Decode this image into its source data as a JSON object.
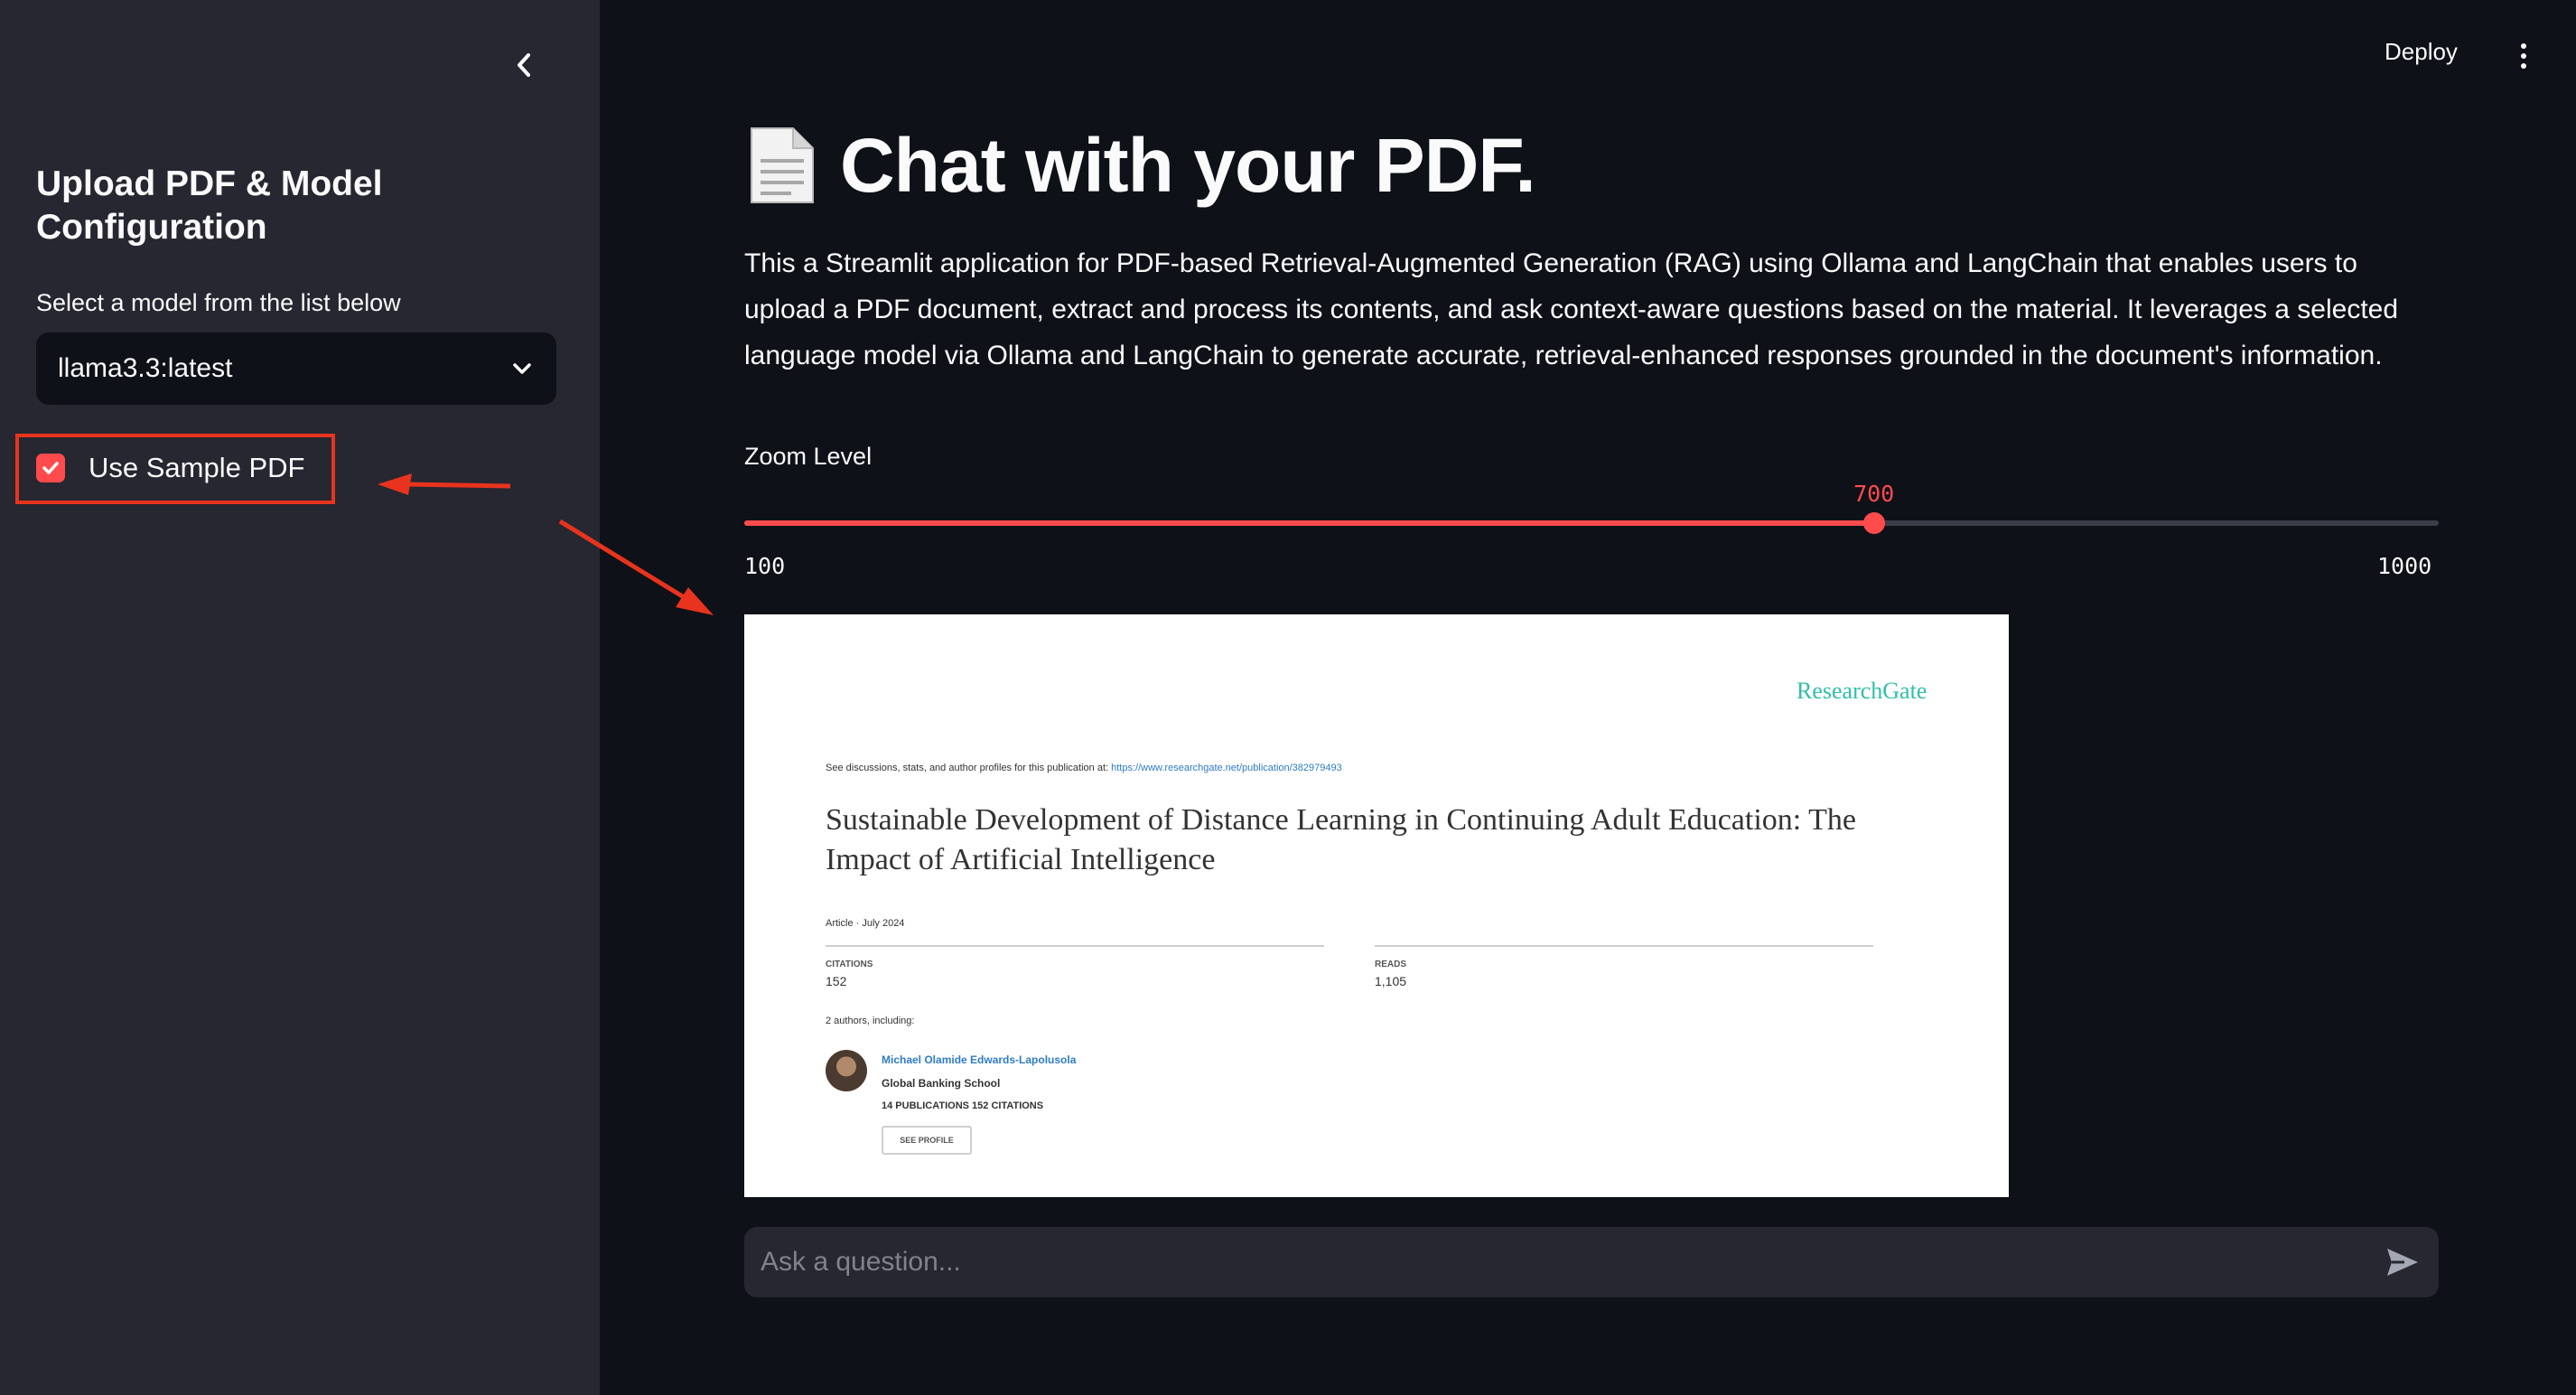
{
  "sidebar": {
    "title": "Upload PDF & Model Configuration",
    "model_label": "Select a model from the list below",
    "model_selected": "llama3.3:latest",
    "sample_checkbox_label": "Use Sample PDF",
    "sample_checked": true
  },
  "header": {
    "deploy_label": "Deploy"
  },
  "main": {
    "title": "Chat with your PDF.",
    "title_icon": "page-document-icon",
    "intro": "This a Streamlit application for PDF-based Retrieval-Augmented Generation (RAG) using Ollama and LangChain that enables users to upload a PDF document, extract and process its contents, and ask context-aware questions based on the material. It leverages a selected language model via Ollama and LangChain to generate accurate, retrieval-enhanced responses grounded in the document's information.",
    "zoom": {
      "label": "Zoom Level",
      "value": 700,
      "min": 100,
      "max": 1000,
      "value_text": "700",
      "min_text": "100",
      "max_text": "1000"
    },
    "pdf_preview": {
      "logo": "ResearchGate",
      "discussion_prefix": "See discussions, stats, and author profiles for this publication at:",
      "discussion_link": "https://www.researchgate.net/publication/382979493",
      "title": "Sustainable Development of Distance Learning in Continuing Adult Education: The Impact of Artificial Intelligence",
      "article_date": "Article · July 2024",
      "citations_label": "CITATIONS",
      "citations_value": "152",
      "reads_label": "READS",
      "reads_value": "1,105",
      "authors_line": "2 authors, including:",
      "author_name": "Michael Olamide Edwards-Lapolusola",
      "author_institution": "Global Banking School",
      "author_stats": "14 PUBLICATIONS   152 CITATIONS",
      "profile_button": "SEE PROFILE"
    },
    "chat": {
      "placeholder": "Ask a question..."
    }
  },
  "colors": {
    "accent": "#ff4b4b",
    "annotation": "#e8331e",
    "background": "#0e1117",
    "sidebar": "#262730"
  }
}
